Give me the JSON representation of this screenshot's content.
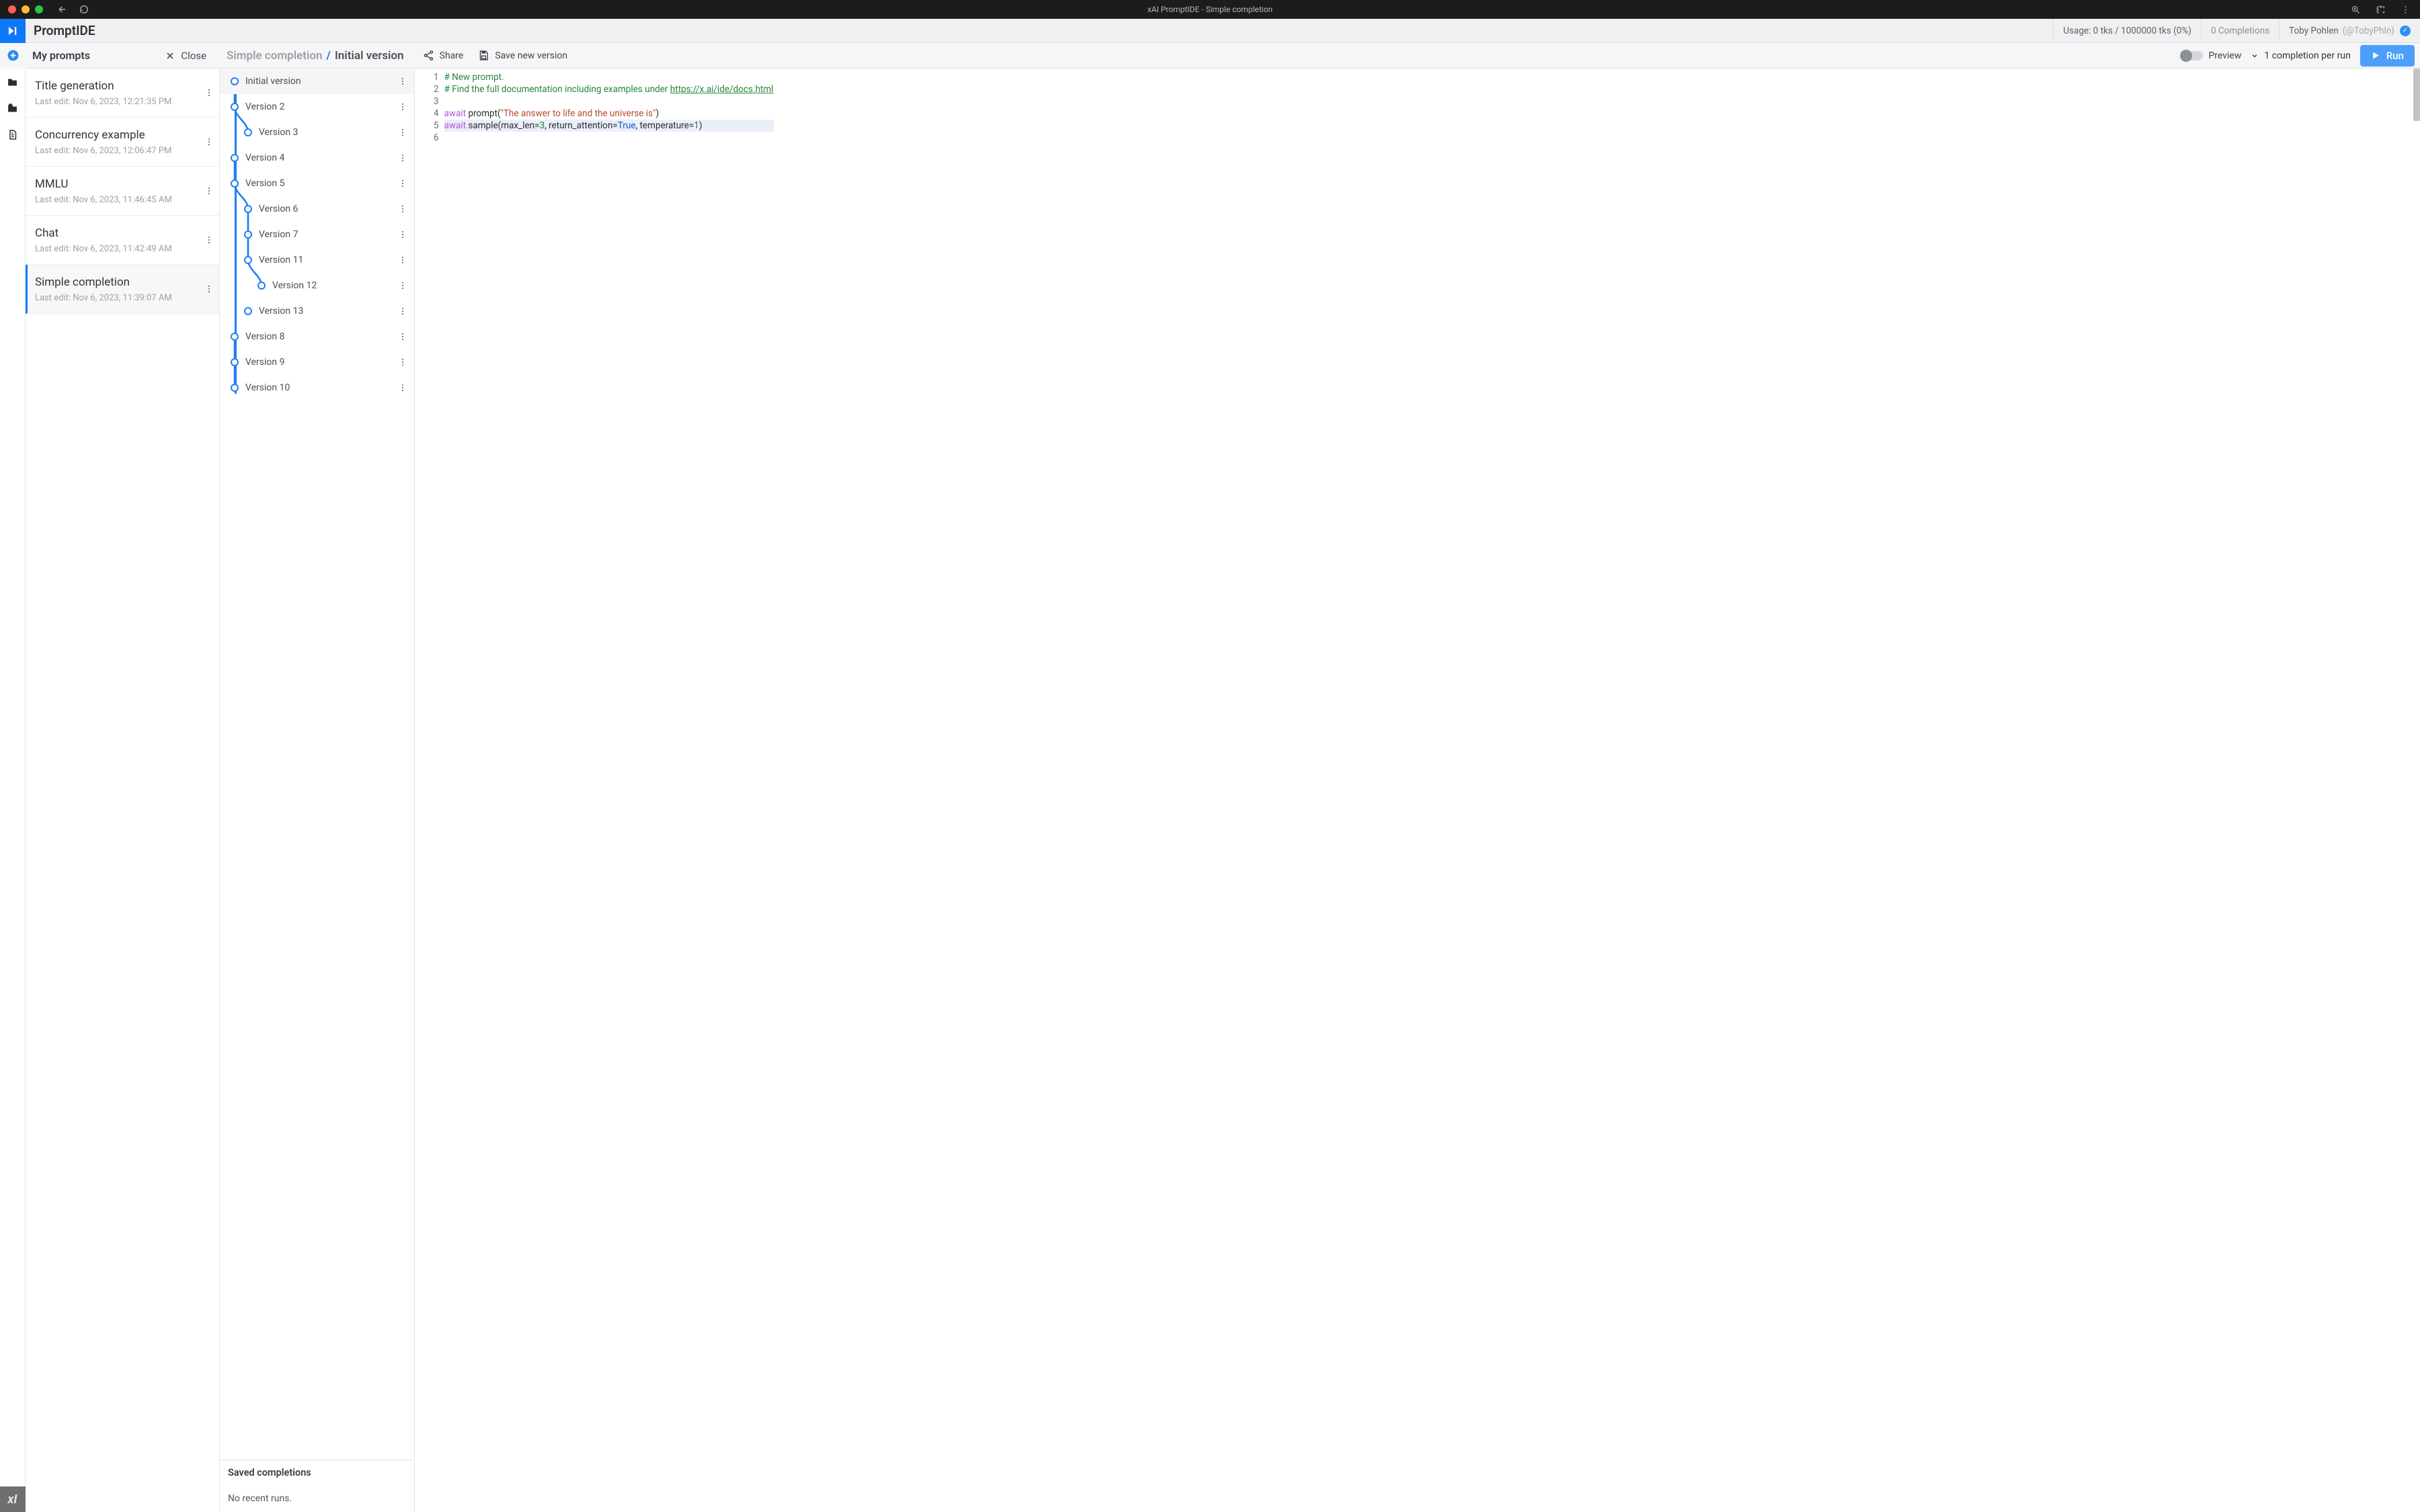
{
  "chrome": {
    "title": "xAI PromptIDE - Simple completion"
  },
  "header": {
    "app_title": "PromptIDE",
    "usage": "Usage: 0 tks / 1000000 tks (0%)",
    "completions": "0 Completions",
    "user_name": "Toby Pohlen",
    "user_handle": "(@TobyPhln)"
  },
  "toolrow": {
    "panel_title": "My prompts",
    "close": "Close",
    "breadcrumb_a": "Simple completion",
    "breadcrumb_b": "Initial version",
    "share": "Share",
    "save": "Save new version",
    "preview": "Preview",
    "completion_select": "1 completion per run",
    "run": "Run"
  },
  "prompts": [
    {
      "title": "Title generation",
      "sub": "Last edit: Nov 6, 2023, 12:21:35 PM"
    },
    {
      "title": "Concurrency example",
      "sub": "Last edit: Nov 6, 2023, 12:06:47 PM"
    },
    {
      "title": "MMLU",
      "sub": "Last edit: Nov 6, 2023, 11:46:45 AM"
    },
    {
      "title": "Chat",
      "sub": "Last edit: Nov 6, 2023, 11:42:49 AM"
    },
    {
      "title": "Simple completion",
      "sub": "Last edit: Nov 6, 2023, 11:39:07 AM",
      "active": true
    }
  ],
  "versions": {
    "items": [
      {
        "label": "Initial version",
        "depth": 0,
        "sel": true
      },
      {
        "label": "Version 2",
        "depth": 0
      },
      {
        "label": "Version 3",
        "depth": 1
      },
      {
        "label": "Version 4",
        "depth": 0
      },
      {
        "label": "Version 5",
        "depth": 0
      },
      {
        "label": "Version 6",
        "depth": 1
      },
      {
        "label": "Version 7",
        "depth": 1
      },
      {
        "label": "Version 11",
        "depth": 1
      },
      {
        "label": "Version 12",
        "depth": 2
      },
      {
        "label": "Version 13",
        "depth": 1
      },
      {
        "label": "Version 8",
        "depth": 0
      },
      {
        "label": "Version 9",
        "depth": 0
      },
      {
        "label": "Version 10",
        "depth": 0
      }
    ],
    "saved_header": "Saved completions",
    "saved_empty": "No recent runs."
  },
  "editor": {
    "lines": [
      [
        {
          "t": "# New prompt.",
          "c": "c-comment"
        }
      ],
      [
        {
          "t": "# Find the full documentation including examples under ",
          "c": "c-comment"
        },
        {
          "t": "https://x.ai/ide/docs.html",
          "c": "c-link"
        }
      ],
      [],
      [
        {
          "t": "await",
          "c": "c-kw"
        },
        {
          "t": " prompt",
          "c": "c-ident"
        },
        {
          "t": "(",
          "c": "c-paren"
        },
        {
          "t": "\"The answer to life and the universe is\"",
          "c": "c-str"
        },
        {
          "t": ")",
          "c": "c-paren"
        }
      ],
      [
        {
          "t": "await",
          "c": "c-kw"
        },
        {
          "t": " sample",
          "c": "c-ident"
        },
        {
          "t": "(",
          "c": "c-paren"
        },
        {
          "t": "max_len",
          "c": "c-ident"
        },
        {
          "t": "=",
          "c": "c-paren"
        },
        {
          "t": "3",
          "c": "c-num"
        },
        {
          "t": ", return_attention",
          "c": "c-ident"
        },
        {
          "t": "=",
          "c": "c-paren"
        },
        {
          "t": "True",
          "c": "c-bool"
        },
        {
          "t": ", temperature",
          "c": "c-ident"
        },
        {
          "t": "=",
          "c": "c-paren"
        },
        {
          "t": "1",
          "c": "c-num"
        },
        {
          "t": ")",
          "c": "c-paren"
        }
      ],
      []
    ]
  }
}
